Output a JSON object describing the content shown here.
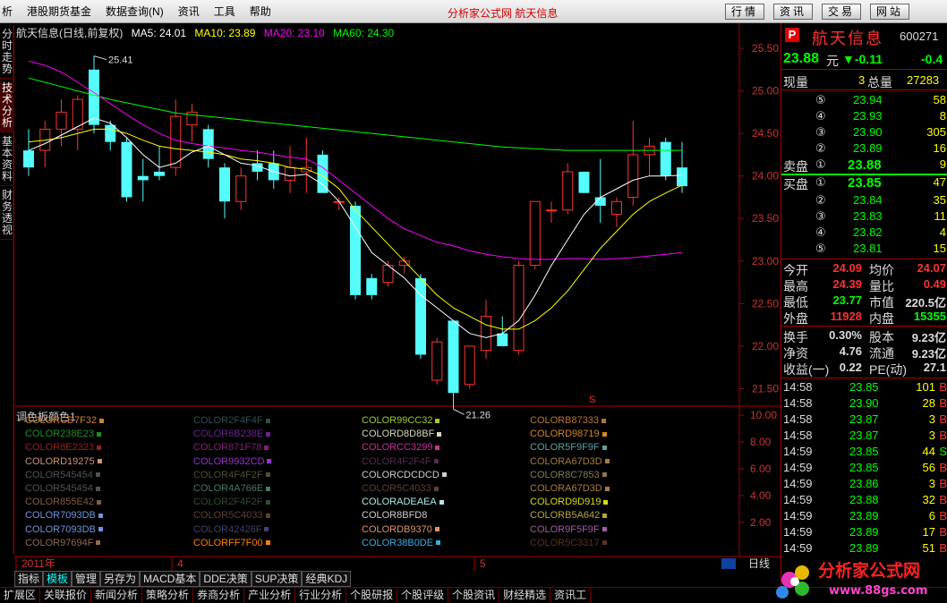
{
  "menu": {
    "items": [
      "析",
      "港股期货基金",
      "数据查询(N)",
      "资讯",
      "工具",
      "帮助"
    ],
    "center_title": "分析家公式网  航天信息",
    "right_buttons": [
      "行情",
      "资讯",
      "交易",
      "网站"
    ]
  },
  "side_tabs": [
    "分时走势",
    "技术分析",
    "基本资料",
    "财务透视"
  ],
  "chart": {
    "stock_name": "航天信息(日线,前复权)",
    "ma5": "MA5: 24.01",
    "ma10": "MA10: 23.89",
    "ma20": "MA20: 23.10",
    "ma60": "MA60: 24.30",
    "high_mark": "25.41",
    "low_mark": "21.26",
    "y_labels": [
      "25.50",
      "25.00",
      "24.50",
      "24.00",
      "23.50",
      "23.00",
      "22.50",
      "22.00",
      "21.50"
    ],
    "sub_y_labels": [
      "10.00",
      "8.00",
      "6.00",
      "4.00",
      "2.00"
    ],
    "date_labels": [
      "2011年",
      "4",
      "5"
    ],
    "period_label": "日线",
    "colors": {
      "up": "#ff3232",
      "down": "#54fcfc",
      "ma5": "#ffffff",
      "ma10": "#ffff00",
      "ma20": "#ff00ff",
      "ma60": "#00ff00"
    }
  },
  "chart_data": {
    "type": "candlestick",
    "candles": [
      {
        "o": 24.3,
        "h": 24.55,
        "l": 24.0,
        "c": 24.1
      },
      {
        "o": 24.3,
        "h": 24.65,
        "l": 24.1,
        "c": 24.55
      },
      {
        "o": 24.55,
        "h": 24.9,
        "l": 24.35,
        "c": 24.75
      },
      {
        "o": 24.55,
        "h": 24.95,
        "l": 24.3,
        "c": 24.9
      },
      {
        "o": 25.25,
        "h": 25.41,
        "l": 24.5,
        "c": 24.6
      },
      {
        "o": 24.6,
        "h": 24.65,
        "l": 24.3,
        "c": 24.4
      },
      {
        "o": 24.4,
        "h": 24.45,
        "l": 23.7,
        "c": 23.75
      },
      {
        "o": 24.0,
        "h": 24.2,
        "l": 23.7,
        "c": 23.95
      },
      {
        "o": 24.05,
        "h": 24.35,
        "l": 23.95,
        "c": 24.0
      },
      {
        "o": 24.1,
        "h": 24.9,
        "l": 24.0,
        "c": 24.7
      },
      {
        "o": 24.6,
        "h": 24.85,
        "l": 24.4,
        "c": 24.75
      },
      {
        "o": 24.55,
        "h": 24.6,
        "l": 24.1,
        "c": 24.2
      },
      {
        "o": 24.1,
        "h": 24.15,
        "l": 23.5,
        "c": 23.7
      },
      {
        "o": 23.7,
        "h": 24.1,
        "l": 23.6,
        "c": 24.0
      },
      {
        "o": 24.15,
        "h": 24.3,
        "l": 23.95,
        "c": 24.05
      },
      {
        "o": 24.15,
        "h": 24.3,
        "l": 23.85,
        "c": 23.95
      },
      {
        "o": 23.95,
        "h": 24.35,
        "l": 23.8,
        "c": 24.1
      },
      {
        "o": 24.05,
        "h": 24.45,
        "l": 23.8,
        "c": 24.1
      },
      {
        "o": 24.25,
        "h": 24.3,
        "l": 23.85,
        "c": 23.8
      },
      {
        "o": 23.7,
        "h": 23.75,
        "l": 23.6,
        "c": 23.7
      },
      {
        "o": 23.65,
        "h": 23.7,
        "l": 22.55,
        "c": 22.6
      },
      {
        "o": 22.8,
        "h": 22.85,
        "l": 22.55,
        "c": 22.6
      },
      {
        "o": 22.75,
        "h": 23.0,
        "l": 22.7,
        "c": 22.95
      },
      {
        "o": 22.95,
        "h": 23.05,
        "l": 22.85,
        "c": 23.0
      },
      {
        "o": 22.8,
        "h": 22.85,
        "l": 21.85,
        "c": 21.9
      },
      {
        "o": 21.6,
        "h": 22.1,
        "l": 21.55,
        "c": 22.05
      },
      {
        "o": 22.3,
        "h": 22.3,
        "l": 21.26,
        "c": 21.45
      },
      {
        "o": 21.55,
        "h": 22.0,
        "l": 21.5,
        "c": 22.0
      },
      {
        "o": 21.95,
        "h": 22.55,
        "l": 21.85,
        "c": 22.35
      },
      {
        "o": 22.15,
        "h": 22.35,
        "l": 22.0,
        "c": 22.0
      },
      {
        "o": 21.95,
        "h": 23.0,
        "l": 21.9,
        "c": 22.95
      },
      {
        "o": 22.95,
        "h": 23.7,
        "l": 22.9,
        "c": 23.7
      },
      {
        "o": 23.6,
        "h": 23.7,
        "l": 23.45,
        "c": 23.6
      },
      {
        "o": 23.6,
        "h": 24.15,
        "l": 23.55,
        "c": 24.05
      },
      {
        "o": 24.05,
        "h": 24.05,
        "l": 23.8,
        "c": 23.8
      },
      {
        "o": 23.75,
        "h": 24.2,
        "l": 23.45,
        "c": 23.65
      },
      {
        "o": 23.55,
        "h": 23.75,
        "l": 23.4,
        "c": 23.7
      },
      {
        "o": 23.75,
        "h": 24.65,
        "l": 23.65,
        "c": 24.25
      },
      {
        "o": 24.25,
        "h": 24.45,
        "l": 24.0,
        "c": 24.35
      },
      {
        "o": 24.4,
        "h": 24.45,
        "l": 23.95,
        "c": 24.0
      },
      {
        "o": 24.1,
        "h": 24.4,
        "l": 23.8,
        "c": 23.88
      }
    ],
    "ma5": [
      24.3,
      24.38,
      24.48,
      24.58,
      24.68,
      24.62,
      24.45,
      24.25,
      24.1,
      24.15,
      24.28,
      24.35,
      24.25,
      24.15,
      24.12,
      24.05,
      24.0,
      24.02,
      23.9,
      23.7,
      23.4,
      23.1,
      22.95,
      22.8,
      22.6,
      22.45,
      22.3,
      22.15,
      22.1,
      22.15,
      22.3,
      22.6,
      22.95,
      23.25,
      23.55,
      23.75,
      23.85,
      23.95,
      24.0,
      24.0,
      24.01
    ],
    "ma10": [
      24.4,
      24.42,
      24.45,
      24.5,
      24.55,
      24.55,
      24.5,
      24.42,
      24.35,
      24.32,
      24.3,
      24.28,
      24.25,
      24.2,
      24.18,
      24.15,
      24.1,
      24.08,
      24.0,
      23.85,
      23.6,
      23.4,
      23.2,
      23.0,
      22.8,
      22.6,
      22.45,
      22.35,
      22.25,
      22.2,
      22.2,
      22.3,
      22.45,
      22.65,
      22.9,
      23.15,
      23.35,
      23.55,
      23.7,
      23.8,
      23.89
    ],
    "ma20": [
      25.35,
      25.3,
      25.22,
      25.1,
      24.98,
      24.85,
      24.72,
      24.6,
      24.5,
      24.42,
      24.38,
      24.35,
      24.33,
      24.3,
      24.28,
      24.25,
      24.22,
      24.2,
      24.1,
      23.95,
      23.8,
      23.65,
      23.5,
      23.38,
      23.3,
      23.22,
      23.18,
      23.12,
      23.08,
      23.05,
      23.03,
      23.02,
      23.02,
      23.03,
      23.03,
      23.02,
      23.03,
      23.04,
      23.06,
      23.08,
      23.1
    ],
    "ma60": [
      25.15,
      25.1,
      25.05,
      25.0,
      24.95,
      24.9,
      24.86,
      24.82,
      24.78,
      24.74,
      24.72,
      24.7,
      24.68,
      24.66,
      24.64,
      24.62,
      24.6,
      24.58,
      24.56,
      24.54,
      24.52,
      24.5,
      24.48,
      24.46,
      24.44,
      24.42,
      24.4,
      24.38,
      24.36,
      24.34,
      24.33,
      24.32,
      24.31,
      24.3,
      24.3,
      24.3,
      24.3,
      24.3,
      24.3,
      24.3,
      24.3
    ],
    "ylim": [
      21.2,
      25.7
    ]
  },
  "quote": {
    "p": "P",
    "name": "航天信息",
    "code": "600271",
    "price": "23.88",
    "unit": "元",
    "change": "▼-0.11",
    "pct": "-0.4",
    "now_vol_label": "现量",
    "now_vol": "3",
    "total_vol_label": "总量",
    "total_vol": "27283",
    "sell": [
      {
        "lv": "⑤",
        "p": "23.94",
        "v": "58"
      },
      {
        "lv": "④",
        "p": "23.93",
        "v": "8"
      },
      {
        "lv": "③",
        "p": "23.90",
        "v": "305"
      },
      {
        "lv": "②",
        "p": "23.89",
        "v": "16"
      }
    ],
    "sell1": {
      "label": "卖盘",
      "lv": "①",
      "p": "23.88",
      "v": "9"
    },
    "buy1": {
      "label": "买盘",
      "lv": "①",
      "p": "23.85",
      "v": "47"
    },
    "buy": [
      {
        "lv": "②",
        "p": "23.84",
        "v": "35"
      },
      {
        "lv": "③",
        "p": "23.83",
        "v": "11"
      },
      {
        "lv": "④",
        "p": "23.82",
        "v": "4"
      },
      {
        "lv": "⑤",
        "p": "23.81",
        "v": "15"
      }
    ],
    "stats": [
      [
        "今开",
        "24.09",
        "均价",
        "24.07"
      ],
      [
        "最高",
        "24.39",
        "量比",
        "0.49"
      ],
      [
        "最低",
        "23.77",
        "市值",
        "220.5亿"
      ],
      [
        "外盘",
        "11928",
        "内盘",
        "15355"
      ],
      [
        "换手",
        "0.30%",
        "股本",
        "9.23亿"
      ],
      [
        "净资",
        "4.76",
        "流通",
        "9.23亿"
      ],
      [
        "收益(一)",
        "0.22",
        "PE(动)",
        "27.1"
      ]
    ],
    "ticks": [
      [
        "14:58",
        "23.85",
        "101",
        "B"
      ],
      [
        "14:58",
        "23.90",
        "28",
        "B"
      ],
      [
        "14:58",
        "23.87",
        "3",
        "B"
      ],
      [
        "14:58",
        "23.87",
        "3",
        "B"
      ],
      [
        "14:59",
        "23.85",
        "44",
        "S"
      ],
      [
        "14:59",
        "23.85",
        "56",
        "B"
      ],
      [
        "14:59",
        "23.86",
        "3",
        "B"
      ],
      [
        "14:59",
        "23.88",
        "32",
        "B"
      ],
      [
        "14:59",
        "23.89",
        "6",
        "B"
      ],
      [
        "14:59",
        "23.89",
        "17",
        "B"
      ],
      [
        "14:59",
        "23.89",
        "51",
        "B"
      ]
    ]
  },
  "palette": {
    "label": "调色板颜色1",
    "cols": [
      [
        [
          "COLORCD7F32",
          "#cd7f32"
        ],
        [
          "COLOR238E23",
          "#238e23"
        ],
        [
          "COLOR8E2323",
          "#8e2323"
        ],
        [
          "COLORD19275",
          "#d19275"
        ],
        [
          "COLOR545454",
          "#545454"
        ],
        [
          "COLOR545454",
          "#545454"
        ],
        [
          "COLOR855E42",
          "#855e42"
        ],
        [
          "COLOR7093DB",
          "#7093db"
        ],
        [
          "COLOR7093DB",
          "#7093db"
        ],
        [
          "COLOR97694F",
          "#97694f"
        ]
      ],
      [
        [
          "COLOR2F4F4F",
          "#2f4f4f"
        ],
        [
          "COLOR6B238E",
          "#6b238e"
        ],
        [
          "COLOR871F78",
          "#871f78"
        ],
        [
          "COLOR9932CD",
          "#9932cd"
        ],
        [
          "COLOR4F4F2F",
          "#4f4f2f"
        ],
        [
          "COLOR4A766E",
          "#4a766e"
        ],
        [
          "COLOR2F4F2F",
          "#2f4f2f"
        ],
        [
          "COLOR5C4033",
          "#5c4033"
        ],
        [
          "COLOR42426F",
          "#42426f"
        ],
        [
          "COLORFF7F00",
          "#ff7f00"
        ]
      ],
      [
        [
          "COLOR99CC32",
          "#99cc32"
        ],
        [
          "COLORD8D8BF",
          "#d8d8bf"
        ],
        [
          "COLORCC3299",
          "#cc3299"
        ],
        [
          "COLOR4F2F4F",
          "#4f2f4f"
        ],
        [
          "COLORCDCDCD",
          "#cdcdcd"
        ],
        [
          "COLOR5C4033",
          "#5c4033"
        ],
        [
          "COLORADEAEA",
          "#adeaea"
        ],
        [
          "COLOR8BFD8",
          "#8bfd8"
        ],
        [
          "COLORDB9370",
          "#db9370"
        ],
        [
          "COLOR38B0DE",
          "#38b0de"
        ]
      ],
      [
        [
          "COLORB87333",
          "#b87333"
        ],
        [
          "COLORD98719",
          "#d98719"
        ],
        [
          "COLOR5F9F9F",
          "#5f9f9f"
        ],
        [
          "COLORA67D3D",
          "#a67d3d"
        ],
        [
          "COLOR8C7853",
          "#8c7853"
        ],
        [
          "COLORA67D3D",
          "#a67d3d"
        ],
        [
          "COLORD9D919",
          "#d9d919"
        ],
        [
          "COLORB5A642",
          "#b5a642"
        ],
        [
          "COLOR9F5F9F",
          "#9f5f9f"
        ],
        [
          "COLOR5C3317",
          "#5c3317"
        ]
      ]
    ]
  },
  "bottom_tabs": [
    "指标",
    "模板",
    "管理",
    "另存为",
    "MACD基本",
    "DDE决策",
    "SUP决策",
    "经典KDJ"
  ],
  "status_bar": [
    "扩展区",
    "关联报价",
    "新闻分析",
    "策略分析",
    "券商分析",
    "产业分析",
    "行业分析",
    "个股研报",
    "个股评级",
    "个股资讯",
    "财经精选",
    "资讯工"
  ],
  "logo": {
    "text": "分析家公式网",
    "url": "www.88gs.com"
  }
}
